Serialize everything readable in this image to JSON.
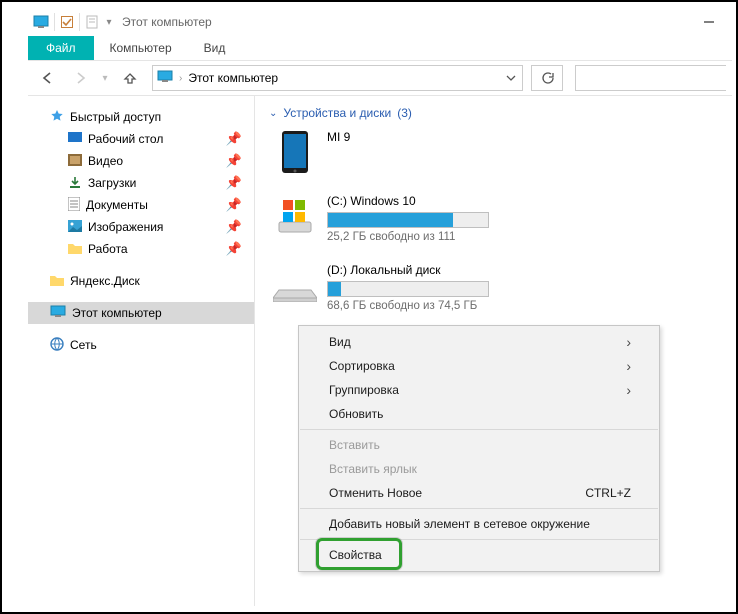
{
  "title": "Этот компьютер",
  "menu": {
    "file": "Файл",
    "computer": "Компьютер",
    "view": "Вид"
  },
  "breadcrumb": "Этот компьютер",
  "nav": {
    "quick": "Быстрый доступ",
    "desktop": "Рабочий стол",
    "video": "Видео",
    "downloads": "Загрузки",
    "documents": "Документы",
    "images": "Изображения",
    "work": "Работа",
    "yadisk": "Яндекс.Диск",
    "thispc": "Этот компьютер",
    "network": "Сеть"
  },
  "group": {
    "title": "Устройства и диски",
    "count": "(3)"
  },
  "drives": {
    "phone": {
      "name": "MI 9"
    },
    "c": {
      "name": "(C:) Windows 10",
      "stat": "25,2 ГБ свободно из 111",
      "fillpct": 78
    },
    "d": {
      "name": "(D:) Локальный диск",
      "stat": "68,6 ГБ свободно из 74,5 ГБ",
      "fillpct": 8
    }
  },
  "ctx": {
    "view": "Вид",
    "sort": "Сортировка",
    "group": "Группировка",
    "refresh": "Обновить",
    "paste": "Вставить",
    "pasteShortcut": "Вставить ярлык",
    "undo": "Отменить Новое",
    "undoKey": "CTRL+Z",
    "addNet": "Добавить новый элемент в сетевое окружение",
    "props": "Свойства"
  }
}
